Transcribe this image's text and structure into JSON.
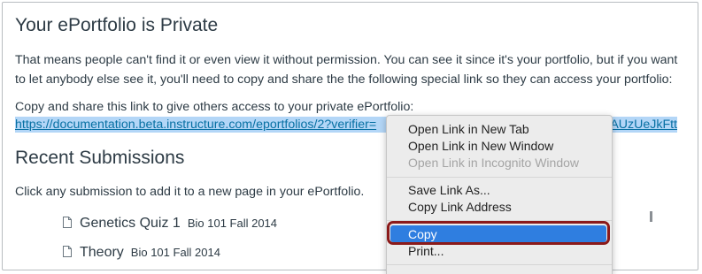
{
  "heading_private": "Your ePortfolio is Private",
  "privacy_paragraph": "That means people can't find it or even view it without permission. You can see it since it's your portfolio, but if you want to let anybody else see it, you'll need to copy and share the the following special link so they can access your portfolio:",
  "copy_share_label": "Copy and share this link to give others access to your private ePortfolio:",
  "share_link": {
    "visible_start": "https://documentation.beta.instructure.com/eportfolios/2?verifier=",
    "visible_end": "AUzUeJkFtt",
    "highlight_color": "#b3d6f7",
    "link_color": "#0770a3"
  },
  "heading_recent": "Recent Submissions",
  "recent_instruction": "Click any submission to add it to a new page in your ePortfolio.",
  "submissions": [
    {
      "title": "Genetics Quiz 1",
      "course": "Bio 101 Fall 2014",
      "icon": "document-icon"
    },
    {
      "title": "Theory",
      "course": "Bio 101 Fall 2014",
      "icon": "document-icon"
    }
  ],
  "context_menu": {
    "items_group1": [
      {
        "label": "Open Link in New Tab",
        "enabled": true
      },
      {
        "label": "Open Link in New Window",
        "enabled": true
      },
      {
        "label": "Open Link in Incognito Window",
        "enabled": false
      }
    ],
    "items_group2": [
      {
        "label": "Save Link As...",
        "enabled": true
      },
      {
        "label": "Copy Link Address",
        "enabled": true
      }
    ],
    "items_group3": [
      {
        "label": "Copy",
        "enabled": true,
        "highlighted": true
      },
      {
        "label": "Print...",
        "enabled": true
      }
    ],
    "highlight_color": "#2f7ee0",
    "callout_color": "#8b1a1a"
  }
}
